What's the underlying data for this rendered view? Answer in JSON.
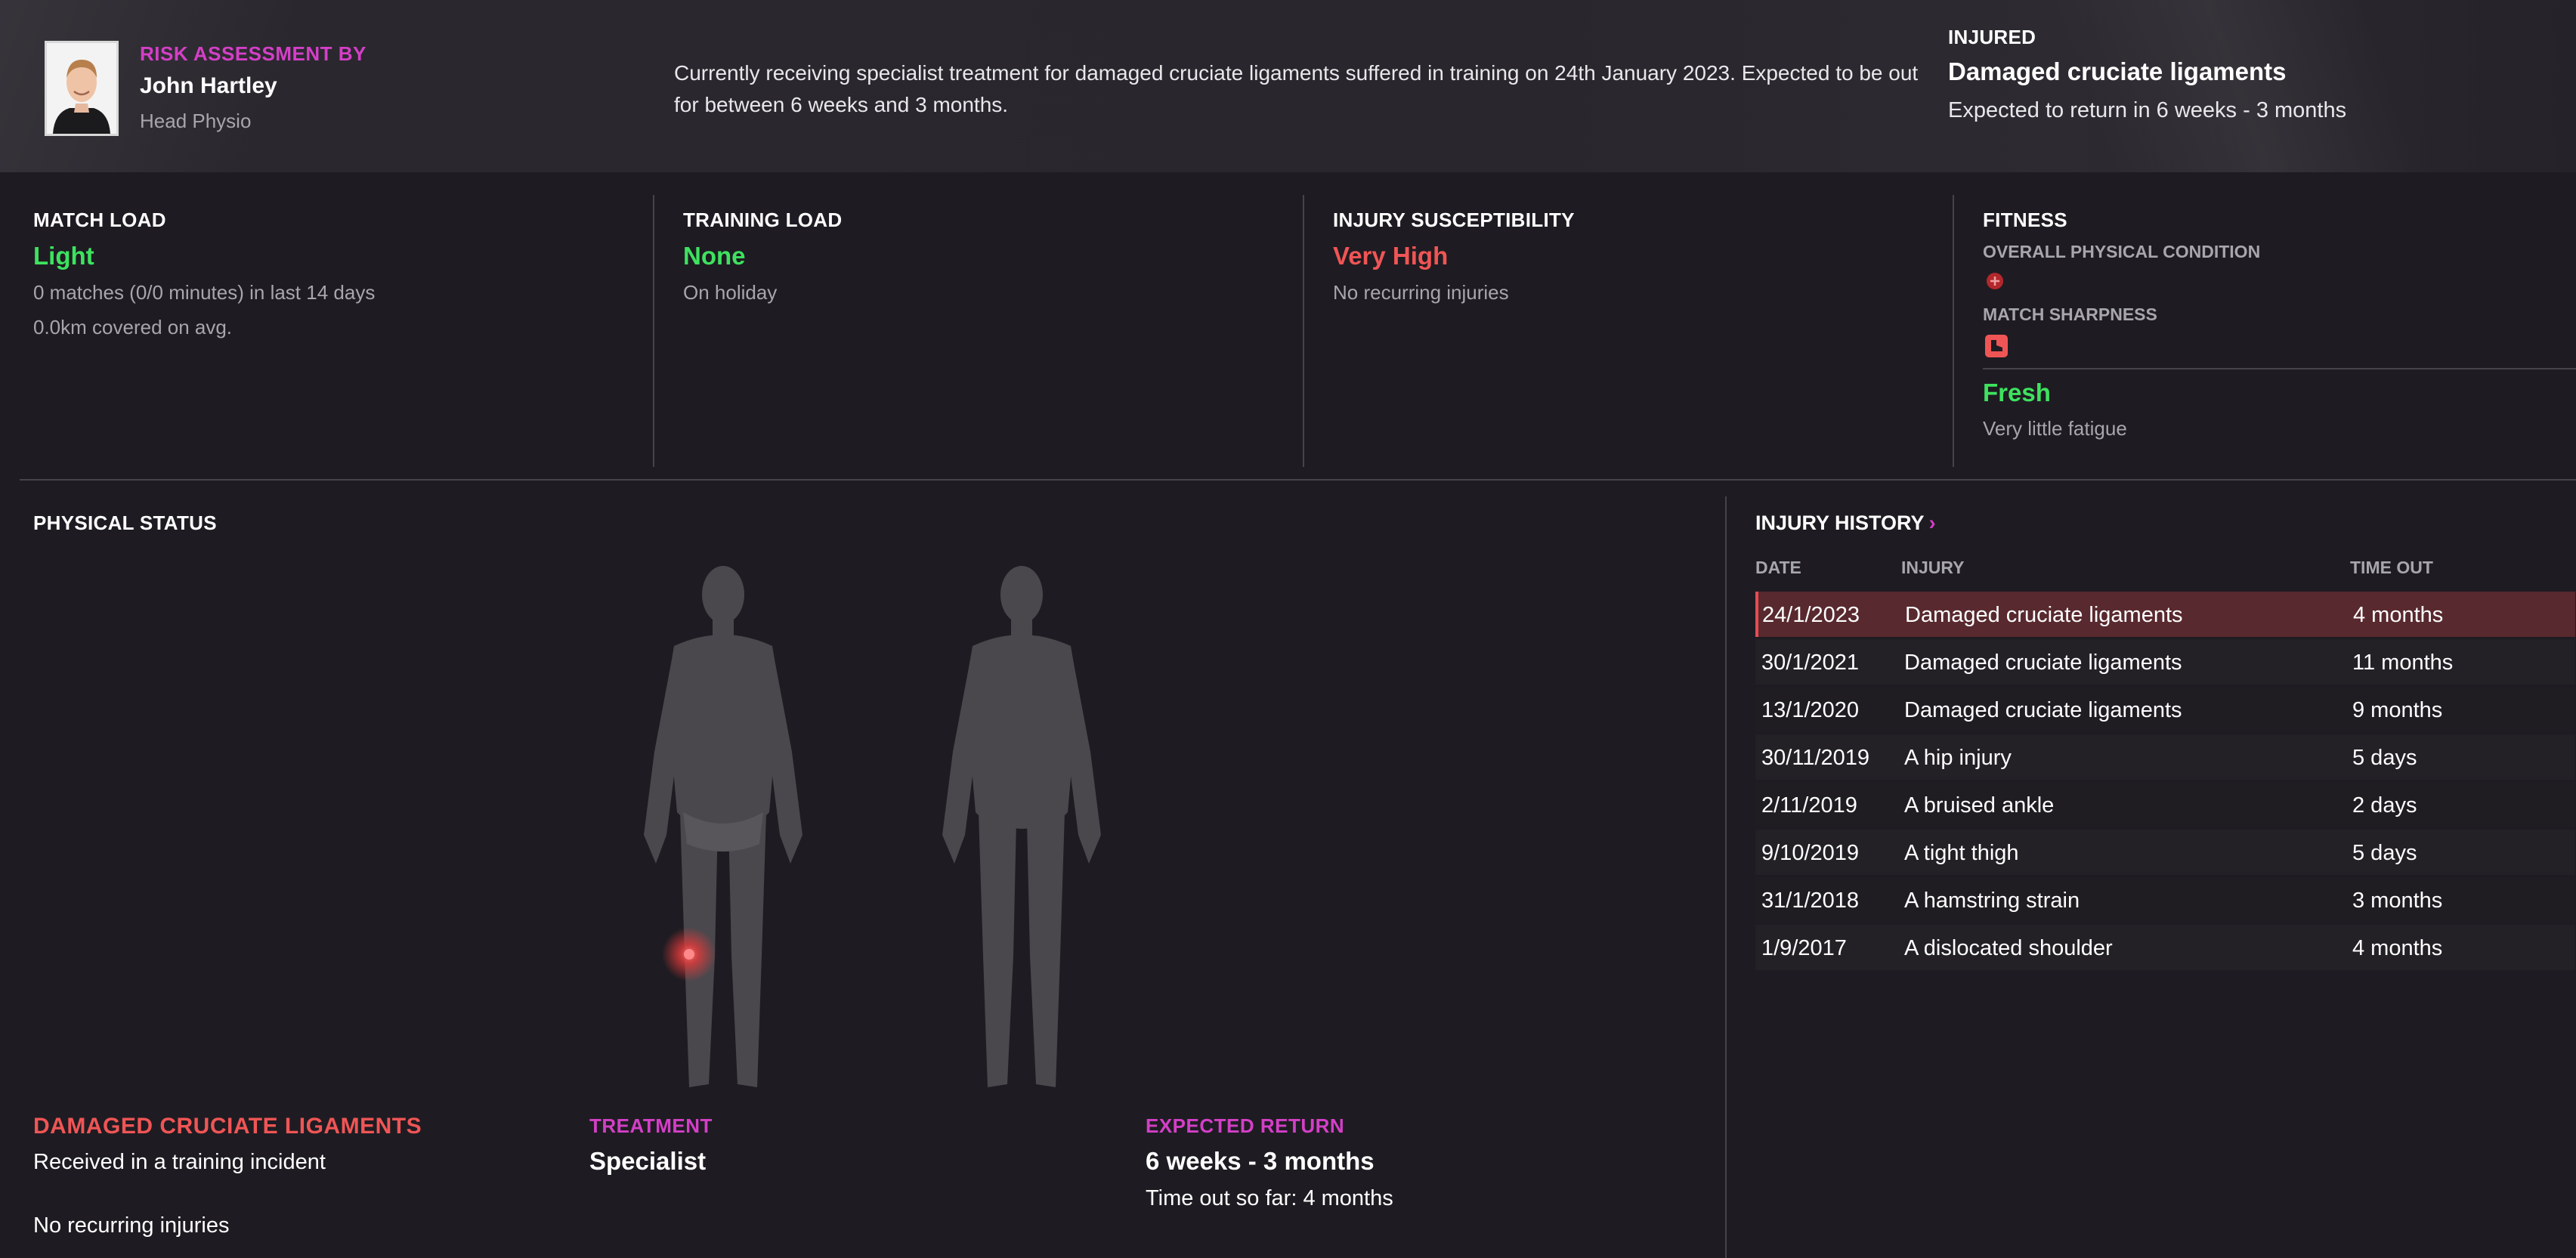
{
  "header": {
    "risk_label": "RISK ASSESSMENT BY",
    "staff_name": "John Hartley",
    "staff_role": "Head Physio",
    "description": "Currently receiving specialist treatment for damaged cruciate ligaments suffered in training on 24th January 2023. Expected to be out for between 6 weeks and 3 months.",
    "status_label": "INJURED",
    "injury_name": "Damaged cruciate ligaments",
    "return_text": "Expected to return in 6 weeks - 3 months"
  },
  "stats": {
    "match_load": {
      "label": "MATCH LOAD",
      "value": "Light",
      "line1": "0 matches (0/0 minutes) in last 14 days",
      "line2": "0.0km covered on avg."
    },
    "training_load": {
      "label": "TRAINING LOAD",
      "value": "None",
      "line1": "On holiday"
    },
    "injury_susceptibility": {
      "label": "INJURY SUSCEPTIBILITY",
      "value": "Very High",
      "line1": "No recurring injuries"
    },
    "fitness": {
      "label": "FITNESS",
      "overall_label": "OVERALL PHYSICAL CONDITION",
      "overall_icon": "plus-circle-icon",
      "sharpness_label": "MATCH SHARPNESS",
      "sharpness_icon": "boot-icon",
      "fatigue_value": "Fresh",
      "fatigue_desc": "Very little fatigue"
    }
  },
  "physical": {
    "title": "PHYSICAL STATUS",
    "injury_title": "DAMAGED CRUCIATE LIGAMENTS",
    "injury_desc": "Received in a training incident",
    "recurring": "No recurring injuries",
    "treatment_label": "TREATMENT",
    "treatment_value": "Specialist",
    "expected_label": "EXPECTED RETURN",
    "expected_value": "6 weeks - 3 months",
    "time_out": "Time out so far: 4 months"
  },
  "history": {
    "title": "INJURY HISTORY",
    "columns": [
      "DATE",
      "INJURY",
      "TIME OUT"
    ],
    "rows": [
      {
        "date": "24/1/2023",
        "injury": "Damaged cruciate ligaments",
        "time_out": "4 months"
      },
      {
        "date": "30/1/2021",
        "injury": "Damaged cruciate ligaments",
        "time_out": "11 months"
      },
      {
        "date": "13/1/2020",
        "injury": "Damaged cruciate ligaments",
        "time_out": "9 months"
      },
      {
        "date": "30/11/2019",
        "injury": "A hip injury",
        "time_out": "5 days"
      },
      {
        "date": "2/11/2019",
        "injury": "A bruised ankle",
        "time_out": "2 days"
      },
      {
        "date": "9/10/2019",
        "injury": "A tight thigh",
        "time_out": "5 days"
      },
      {
        "date": "31/1/2018",
        "injury": "A hamstring strain",
        "time_out": "3 months"
      },
      {
        "date": "1/9/2017",
        "injury": "A dislocated shoulder",
        "time_out": "4 months"
      }
    ]
  },
  "colors": {
    "accent_magenta": "#d43fc7",
    "good_green": "#3ee25f",
    "bad_red": "#f05555",
    "selected_row": "#5a2a2e"
  }
}
